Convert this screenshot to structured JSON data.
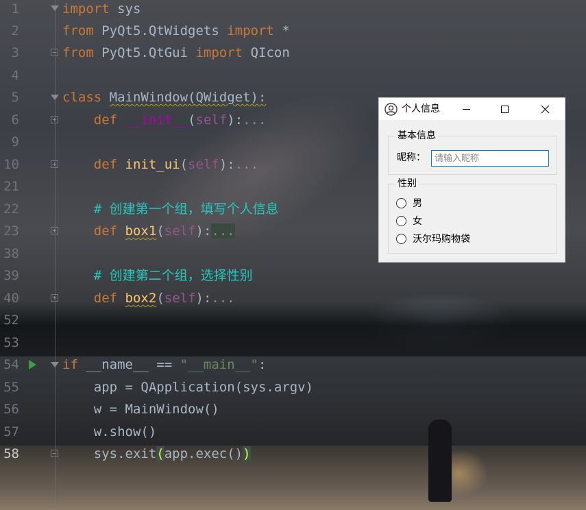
{
  "editor": {
    "lines": [
      {
        "num": "1",
        "tokens": [
          [
            "k",
            "import"
          ],
          [
            "p",
            " sys"
          ]
        ]
      },
      {
        "num": "2",
        "tokens": [
          [
            "k",
            "from"
          ],
          [
            "p",
            " PyQt5.QtWidgets "
          ],
          [
            "k",
            "import"
          ],
          [
            "p",
            " *"
          ]
        ]
      },
      {
        "num": "3",
        "tokens": [
          [
            "k",
            "from"
          ],
          [
            "p",
            " PyQt5.QtGui "
          ],
          [
            "k",
            "import"
          ],
          [
            "p",
            " QIcon"
          ]
        ]
      },
      {
        "num": "4",
        "tokens": []
      },
      {
        "num": "5",
        "tokens": [
          [
            "k",
            "class"
          ],
          [
            "p",
            " "
          ],
          [
            "sq",
            "MainWindow(QWidget):"
          ]
        ]
      },
      {
        "num": "6",
        "tokens": [
          [
            "p",
            "    "
          ],
          [
            "k",
            "def"
          ],
          [
            "p",
            " "
          ],
          [
            "dunder",
            "__init__"
          ],
          [
            "p",
            "("
          ],
          [
            "self",
            "self"
          ],
          [
            "p",
            "):"
          ],
          [
            "fold",
            "..."
          ]
        ]
      },
      {
        "num": "9",
        "tokens": []
      },
      {
        "num": "10",
        "tokens": [
          [
            "p",
            "    "
          ],
          [
            "k",
            "def"
          ],
          [
            "p",
            " "
          ],
          [
            "fn",
            "init_ui"
          ],
          [
            "p",
            "("
          ],
          [
            "self",
            "self"
          ],
          [
            "p",
            "):"
          ],
          [
            "fold",
            "..."
          ]
        ]
      },
      {
        "num": "21",
        "tokens": []
      },
      {
        "num": "22",
        "tokens": [
          [
            "p",
            "    "
          ],
          [
            "cmt",
            "# 创建第一个组，填写个人信息"
          ]
        ]
      },
      {
        "num": "23",
        "tokens": [
          [
            "p",
            "    "
          ],
          [
            "k",
            "def"
          ],
          [
            "p",
            " "
          ],
          [
            "fnsq",
            "box1"
          ],
          [
            "p",
            "("
          ],
          [
            "self",
            "self"
          ],
          [
            "p",
            "):"
          ],
          [
            "dotshl",
            "..."
          ]
        ]
      },
      {
        "num": "38",
        "tokens": []
      },
      {
        "num": "39",
        "tokens": [
          [
            "p",
            "    "
          ],
          [
            "cmt",
            "# 创建第二个组，选择性别"
          ]
        ]
      },
      {
        "num": "40",
        "tokens": [
          [
            "p",
            "    "
          ],
          [
            "k",
            "def"
          ],
          [
            "p",
            " "
          ],
          [
            "fnsq",
            "box2"
          ],
          [
            "p",
            "("
          ],
          [
            "self",
            "self"
          ],
          [
            "p",
            "):"
          ],
          [
            "fold",
            "..."
          ]
        ]
      },
      {
        "num": "52",
        "tokens": []
      },
      {
        "num": "53",
        "tokens": []
      },
      {
        "num": "54",
        "tokens": [
          [
            "k",
            "if"
          ],
          [
            "p",
            " __name__ == "
          ],
          [
            "str",
            "\"__main__\""
          ],
          [
            "p",
            ":"
          ]
        ]
      },
      {
        "num": "55",
        "tokens": [
          [
            "p",
            "    app = QApplication(sys.argv)"
          ]
        ]
      },
      {
        "num": "56",
        "tokens": [
          [
            "p",
            "    w = MainWindow()"
          ]
        ]
      },
      {
        "num": "57",
        "tokens": [
          [
            "p",
            "    w.show()"
          ]
        ]
      },
      {
        "num": "58",
        "tokens": [
          [
            "p",
            "    sys.exit"
          ],
          [
            "paren",
            "("
          ],
          [
            "p",
            "app.exec()"
          ],
          [
            "paren",
            ")"
          ]
        ]
      }
    ]
  },
  "window": {
    "title": "个人信息",
    "group1": {
      "title": "基本信息",
      "nickname_label": "昵称：",
      "nickname_placeholder": "请输入昵称",
      "nickname_value": ""
    },
    "group2": {
      "title": "性别",
      "options": [
        "男",
        "女",
        "沃尔玛购物袋"
      ]
    }
  }
}
